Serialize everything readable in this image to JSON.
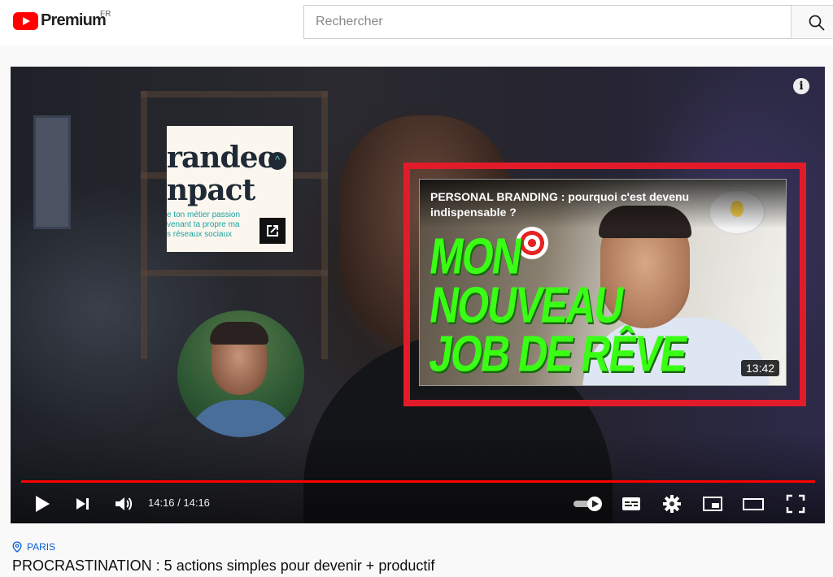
{
  "header": {
    "logo_text": "Premium",
    "country_code": "FR",
    "search_placeholder": "Rechercher"
  },
  "player": {
    "info_icon": "info-icon",
    "sponsor_card": {
      "line1": "randeo",
      "line2": "npact",
      "small_text": [
        "e ton métier passion",
        "venant ta propre ma",
        "s réseaux sociaux"
      ],
      "open_icon": "external-link-icon"
    },
    "endscreen_video": {
      "title": "PERSONAL BRANDING : pourquoi c'est devenu indispensable ?",
      "thumbnail_text": [
        "MON",
        "NOUVEAU",
        "JOB DE RÊVE"
      ],
      "duration": "13:42"
    },
    "controls": {
      "time": "14:16 / 14:16",
      "progress": 1.0,
      "icons": [
        "play-icon",
        "next-icon",
        "volume-icon",
        "autoplay-toggle",
        "subtitles-icon",
        "settings-gear-icon",
        "miniplayer-icon",
        "theater-mode-icon",
        "fullscreen-icon"
      ]
    }
  },
  "video_info": {
    "location": "PARIS",
    "title": "PROCRASTINATION : 5 actions simples pour devenir + productif"
  },
  "colors": {
    "brand_red": "#ff0000",
    "highlight_red": "#e21b2a",
    "thumbnail_green": "#39ff14",
    "link_blue": "#065fd4"
  }
}
